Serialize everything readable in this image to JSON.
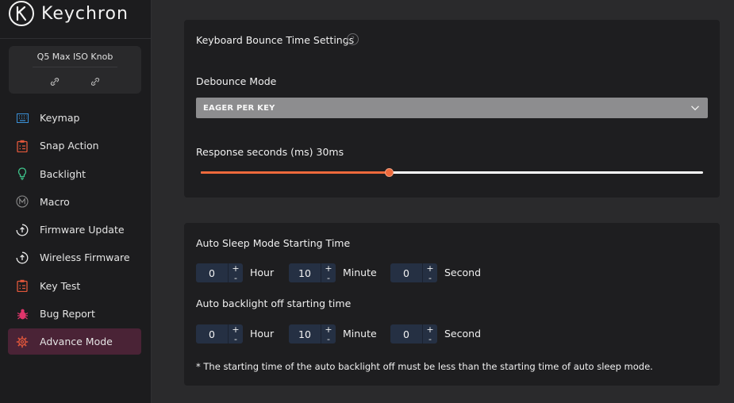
{
  "app": {
    "brand": "Keychron"
  },
  "device": {
    "name": "Q5 Max ISO Knob"
  },
  "sidebar": {
    "items": [
      {
        "label": "Keymap",
        "icon": "keyboard-icon",
        "color": "#3a8fd6"
      },
      {
        "label": "Snap Action",
        "icon": "clipboard-icon",
        "color": "#e2573b"
      },
      {
        "label": "Backlight",
        "icon": "bulb-icon",
        "color": "#3ec48b"
      },
      {
        "label": "Macro",
        "icon": "macro-m-icon",
        "color": "#8a8a8a"
      },
      {
        "label": "Firmware Update",
        "icon": "upload-circle-icon",
        "color": "#e8e8e8"
      },
      {
        "label": "Wireless Firmware",
        "icon": "upload-circle-icon",
        "color": "#e8e8e8"
      },
      {
        "label": "Key Test",
        "icon": "clipboard-icon",
        "color": "#e2573b"
      },
      {
        "label": "Bug Report",
        "icon": "bug-icon",
        "color": "#e0356b"
      },
      {
        "label": "Advance Mode",
        "icon": "gear-icon",
        "color": "#e2573b",
        "active": true
      }
    ]
  },
  "debounce": {
    "title": "Keyboard Bounce Time Settings",
    "help": "?",
    "mode_label": "Debounce Mode",
    "mode_value": "EAGER PER KEY",
    "response_label": "Response seconds (ms) 30ms",
    "response_fraction": 0.374
  },
  "sleep": {
    "title": "Auto Sleep Mode Starting Time",
    "hour": "0",
    "minute": "10",
    "second": "0"
  },
  "backlight_off": {
    "title": "Auto backlight off starting time",
    "hour": "0",
    "minute": "10",
    "second": "0"
  },
  "units": {
    "hour": "Hour",
    "minute": "Minute",
    "second": "Second"
  },
  "stepper": {
    "plus": "+",
    "minus": "-"
  },
  "footnote": "* The starting time of the auto backlight off must be less than the starting time of auto sleep mode.",
  "colors": {
    "accent": "#ef6a3c",
    "active_nav_bg": "#4a2336"
  }
}
